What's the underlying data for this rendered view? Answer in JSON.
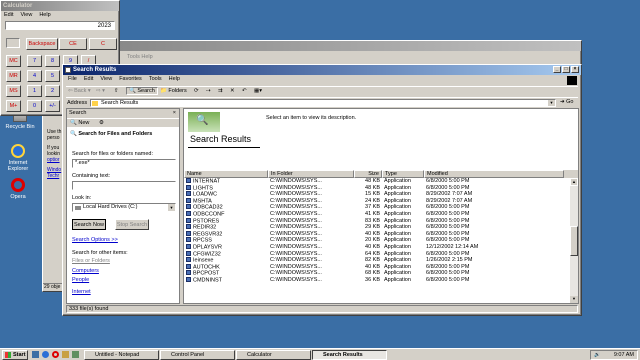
{
  "desktop": {
    "icons": [
      {
        "label": "Recycle Bin"
      },
      {
        "label": "Internet Explorer"
      },
      {
        "label": "Opera"
      }
    ]
  },
  "calculator": {
    "title": "Calculator",
    "menu": [
      "Edit",
      "View",
      "Help"
    ],
    "display": "2023",
    "top_keys": [
      "Backspace",
      "CE",
      "C"
    ],
    "mem_keys": [
      "MC",
      "MR",
      "MS",
      "M+"
    ],
    "keys": [
      [
        "7",
        "8",
        "9",
        "/"
      ],
      [
        "4",
        "5",
        "6",
        "*"
      ],
      [
        "1",
        "2",
        "3",
        "-"
      ],
      [
        "0",
        "+/-",
        ".",
        "+"
      ]
    ]
  },
  "bg_window": {
    "menu_partial": "Tools  Help",
    "status": "29 obje",
    "snippet": [
      "Use th",
      "perso",
      "If you",
      "lookin",
      "optior",
      "Windo",
      "Techr"
    ]
  },
  "search": {
    "title": "Search Results",
    "menu": [
      "File",
      "Edit",
      "View",
      "Favorites",
      "Tools",
      "Help"
    ],
    "toolbar": {
      "back": "Back",
      "search": "Search",
      "folders": "Folders"
    },
    "address_label": "Address",
    "address_value": "Search Results",
    "go": "Go",
    "pane": {
      "title": "Search",
      "new_label": "New",
      "heading": "Search for Files and Folders",
      "named_label": "Search for files or folders named:",
      "named_value": "*.exe*",
      "containing_label": "Containing text:",
      "lookin_label": "Look in:",
      "lookin_value": "Local Hard Drives (C:)",
      "search_now": "Search Now",
      "stop_search": "Stop Search",
      "options": "Search Options >>",
      "other_label": "Search for other items:",
      "other_items": [
        "Files or Folders",
        "Computers",
        "People",
        "Internet"
      ]
    },
    "results_title": "Search Results",
    "select_hint": "Select an item to view its description.",
    "columns": [
      "Name",
      "In Folder",
      "Size",
      "Type",
      "Modified"
    ],
    "rows": [
      [
        "INTERNAT",
        "C:\\WINDOWS\\SYS...",
        "48 KB",
        "Application",
        "6/8/2000 5:00 PM"
      ],
      [
        "LIGHTS",
        "C:\\WINDOWS\\SYS...",
        "48 KB",
        "Application",
        "6/8/2000 5:00 PM"
      ],
      [
        "LOADWC",
        "C:\\WINDOWS\\SYS...",
        "15 KB",
        "Application",
        "8/29/2002 7:07 AM"
      ],
      [
        "MSHTA",
        "C:\\WINDOWS\\SYS...",
        "24 KB",
        "Application",
        "8/29/2002 7:07 AM"
      ],
      [
        "ODBCAD32",
        "C:\\WINDOWS\\SYS...",
        "37 KB",
        "Application",
        "6/8/2000 5:00 PM"
      ],
      [
        "ODBCCONF",
        "C:\\WINDOWS\\SYS...",
        "41 KB",
        "Application",
        "6/8/2000 5:00 PM"
      ],
      [
        "PSTORES",
        "C:\\WINDOWS\\SYS...",
        "83 KB",
        "Application",
        "6/8/2000 5:00 PM"
      ],
      [
        "REDIR32",
        "C:\\WINDOWS\\SYS...",
        "29 KB",
        "Application",
        "6/8/2000 5:00 PM"
      ],
      [
        "REGSVR32",
        "C:\\WINDOWS\\SYS...",
        "40 KB",
        "Application",
        "6/8/2000 5:00 PM"
      ],
      [
        "RPCSS",
        "C:\\WINDOWS\\SYS...",
        "20 KB",
        "Application",
        "6/8/2000 5:00 PM"
      ],
      [
        "DPLAYSVR",
        "C:\\WINDOWS\\SYS...",
        "40 KB",
        "Application",
        "12/12/2002 12:14 AM"
      ],
      [
        "CFGWIZ32",
        "C:\\WINDOWS\\SYS...",
        "64 KB",
        "Application",
        "6/8/2000 5:00 PM"
      ],
      [
        "Ieinsexe",
        "C:\\WINDOWS\\SYS...",
        "82 KB",
        "Application",
        "1/26/2002 2:15 PM"
      ],
      [
        "AUTOCHK",
        "C:\\WINDOWS\\SYS...",
        "40 KB",
        "Application",
        "6/8/2000 5:00 PM"
      ],
      [
        "BPCPOST",
        "C:\\WINDOWS\\SYS...",
        "68 KB",
        "Application",
        "6/8/2000 5:00 PM"
      ],
      [
        "CMDNINST",
        "C:\\WINDOWS\\SYS...",
        "36 KB",
        "Application",
        "6/8/2000 5:00 PM"
      ]
    ],
    "status": "333 file(s) found"
  },
  "taskbar": {
    "start": "Start",
    "buttons": [
      "Untitled - Notepad",
      "Control Panel",
      "Calculator",
      "Search Results"
    ],
    "time": "9:07 AM"
  }
}
